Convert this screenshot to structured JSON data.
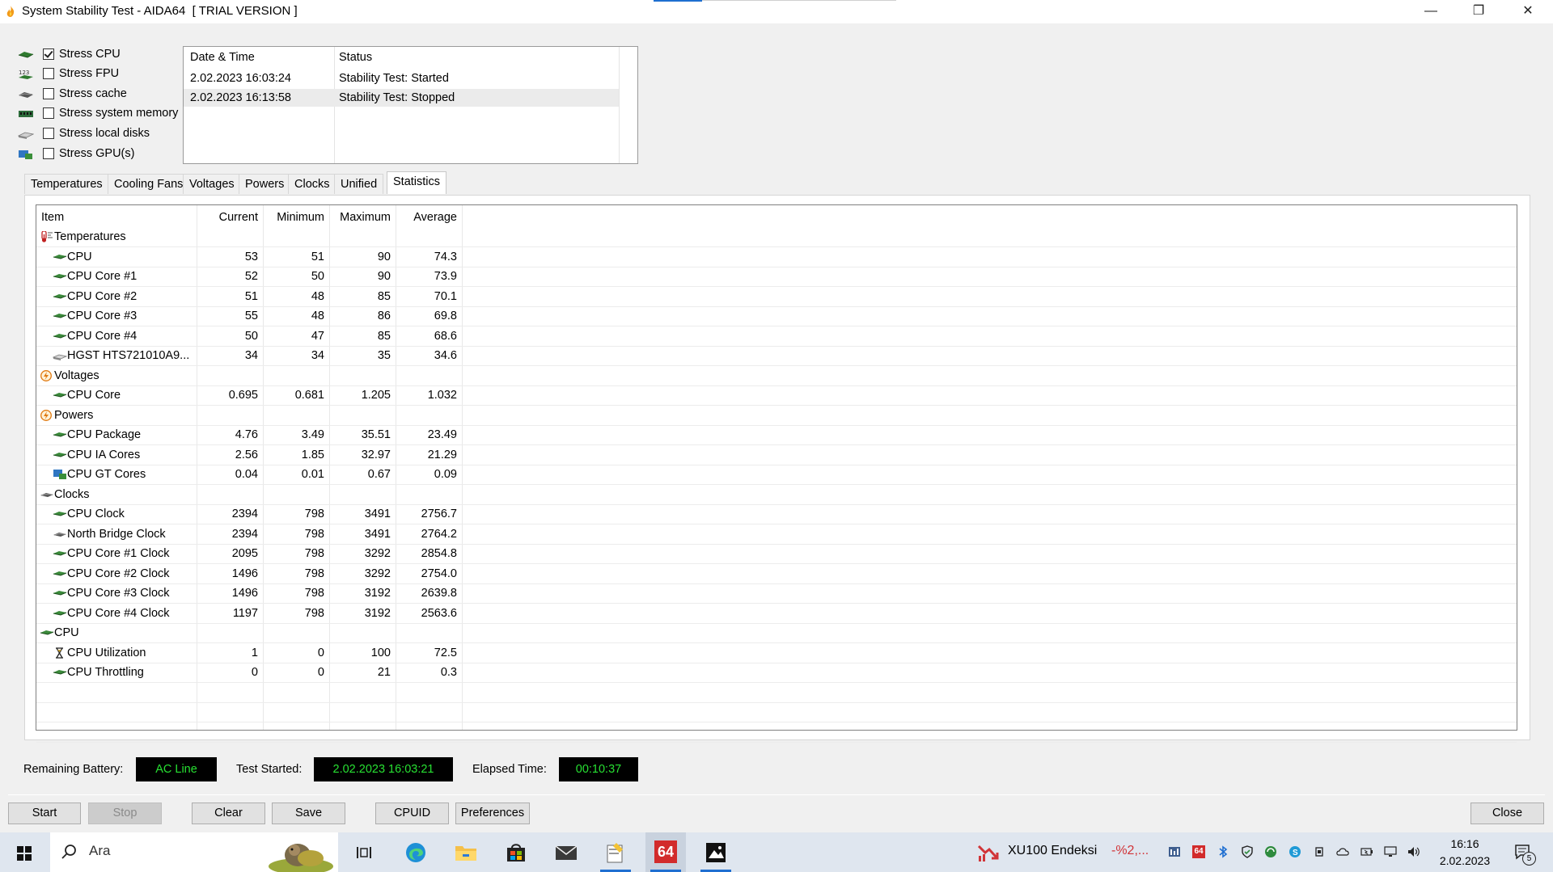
{
  "window": {
    "title": "System Stability Test - AIDA64  [ TRIAL VERSION ]",
    "controls": {
      "minimize": "—",
      "restore": "❐",
      "close": "✕"
    }
  },
  "stress_options": [
    {
      "label": "Stress CPU",
      "checked": true,
      "icon": "cpu-chip-icon"
    },
    {
      "label": "Stress FPU",
      "checked": false,
      "icon": "fpu-123-icon"
    },
    {
      "label": "Stress cache",
      "checked": false,
      "icon": "cache-icon"
    },
    {
      "label": "Stress system memory",
      "checked": false,
      "icon": "memory-module-icon"
    },
    {
      "label": "Stress local disks",
      "checked": false,
      "icon": "disk-drive-icon"
    },
    {
      "label": "Stress GPU(s)",
      "checked": false,
      "icon": "gpu-card-icon"
    }
  ],
  "log": {
    "headers": {
      "datetime": "Date & Time",
      "status": "Status"
    },
    "rows": [
      {
        "datetime": "2.02.2023 16:03:24",
        "status": "Stability Test: Started"
      },
      {
        "datetime": "2.02.2023 16:13:58",
        "status": "Stability Test: Stopped"
      }
    ]
  },
  "tabs": [
    {
      "label": "Temperatures",
      "active": false
    },
    {
      "label": "Cooling Fans",
      "active": false
    },
    {
      "label": "Voltages",
      "active": false
    },
    {
      "label": "Powers",
      "active": false
    },
    {
      "label": "Clocks",
      "active": false
    },
    {
      "label": "Unified",
      "active": false
    },
    {
      "label": "Statistics",
      "active": true
    }
  ],
  "stats": {
    "headers": {
      "item": "Item",
      "current": "Current",
      "minimum": "Minimum",
      "maximum": "Maximum",
      "average": "Average"
    },
    "rows": [
      {
        "type": "group",
        "item": "Temperatures",
        "icon": "thermometer-icon"
      },
      {
        "type": "row",
        "item": "CPU",
        "icon": "cpu-chip-icon",
        "current": "53",
        "minimum": "51",
        "maximum": "90",
        "average": "74.3"
      },
      {
        "type": "row",
        "item": "CPU Core #1",
        "icon": "cpu-chip-icon",
        "current": "52",
        "minimum": "50",
        "maximum": "90",
        "average": "73.9"
      },
      {
        "type": "row",
        "item": "CPU Core #2",
        "icon": "cpu-chip-icon",
        "current": "51",
        "minimum": "48",
        "maximum": "85",
        "average": "70.1"
      },
      {
        "type": "row",
        "item": "CPU Core #3",
        "icon": "cpu-chip-icon",
        "current": "55",
        "minimum": "48",
        "maximum": "86",
        "average": "69.8"
      },
      {
        "type": "row",
        "item": "CPU Core #4",
        "icon": "cpu-chip-icon",
        "current": "50",
        "minimum": "47",
        "maximum": "85",
        "average": "68.6"
      },
      {
        "type": "row",
        "item": "HGST HTS721010A9...",
        "icon": "disk-drive-icon",
        "current": "34",
        "minimum": "34",
        "maximum": "35",
        "average": "34.6"
      },
      {
        "type": "group",
        "item": "Voltages",
        "icon": "lightning-icon"
      },
      {
        "type": "row",
        "item": "CPU Core",
        "icon": "cpu-chip-icon",
        "current": "0.695",
        "minimum": "0.681",
        "maximum": "1.205",
        "average": "1.032"
      },
      {
        "type": "group",
        "item": "Powers",
        "icon": "lightning-icon"
      },
      {
        "type": "row",
        "item": "CPU Package",
        "icon": "cpu-chip-icon",
        "current": "4.76",
        "minimum": "3.49",
        "maximum": "35.51",
        "average": "23.49"
      },
      {
        "type": "row",
        "item": "CPU IA Cores",
        "icon": "cpu-chip-icon",
        "current": "2.56",
        "minimum": "1.85",
        "maximum": "32.97",
        "average": "21.29"
      },
      {
        "type": "row",
        "item": "CPU GT Cores",
        "icon": "gpu-card-icon",
        "current": "0.04",
        "minimum": "0.01",
        "maximum": "0.67",
        "average": "0.09"
      },
      {
        "type": "group",
        "item": "Clocks",
        "icon": "clock-chip-icon"
      },
      {
        "type": "row",
        "item": "CPU Clock",
        "icon": "cpu-chip-icon",
        "current": "2394",
        "minimum": "798",
        "maximum": "3491",
        "average": "2756.7"
      },
      {
        "type": "row",
        "item": "North Bridge Clock",
        "icon": "clock-chip-icon",
        "current": "2394",
        "minimum": "798",
        "maximum": "3491",
        "average": "2764.2"
      },
      {
        "type": "row",
        "item": "CPU Core #1 Clock",
        "icon": "cpu-chip-icon",
        "current": "2095",
        "minimum": "798",
        "maximum": "3292",
        "average": "2854.8"
      },
      {
        "type": "row",
        "item": "CPU Core #2 Clock",
        "icon": "cpu-chip-icon",
        "current": "1496",
        "minimum": "798",
        "maximum": "3292",
        "average": "2754.0"
      },
      {
        "type": "row",
        "item": "CPU Core #3 Clock",
        "icon": "cpu-chip-icon",
        "current": "1496",
        "minimum": "798",
        "maximum": "3192",
        "average": "2639.8"
      },
      {
        "type": "row",
        "item": "CPU Core #4 Clock",
        "icon": "cpu-chip-icon",
        "current": "1197",
        "minimum": "798",
        "maximum": "3192",
        "average": "2563.6"
      },
      {
        "type": "group",
        "item": "CPU",
        "icon": "cpu-chip-icon"
      },
      {
        "type": "row",
        "item": "CPU Utilization",
        "icon": "hourglass-icon",
        "current": "1",
        "minimum": "0",
        "maximum": "100",
        "average": "72.5"
      },
      {
        "type": "row",
        "item": "CPU Throttling",
        "icon": "cpu-chip-icon",
        "current": "0",
        "minimum": "0",
        "maximum": "21",
        "average": "0.3"
      }
    ]
  },
  "status": {
    "battery_label": "Remaining Battery:",
    "battery_value": "AC Line",
    "started_label": "Test Started:",
    "started_value": "2.02.2023 16:03:21",
    "elapsed_label": "Elapsed Time:",
    "elapsed_value": "00:10:37"
  },
  "buttons": {
    "start": "Start",
    "stop": "Stop",
    "clear": "Clear",
    "save": "Save",
    "cpuid": "CPUID",
    "preferences": "Preferences",
    "close": "Close"
  },
  "taskbar": {
    "search_placeholder": "Ara",
    "aida_label": "64",
    "stock_name": "XU100 Endeksi",
    "stock_change": "-%2,...",
    "time": "16:16",
    "date": "2.02.2023",
    "notification_count": "5"
  },
  "colors": {
    "lcd_text": "#27e032",
    "taskbar": "#dfe6ef",
    "accent": "#1f6fd1",
    "stock_negative": "#d13438"
  }
}
